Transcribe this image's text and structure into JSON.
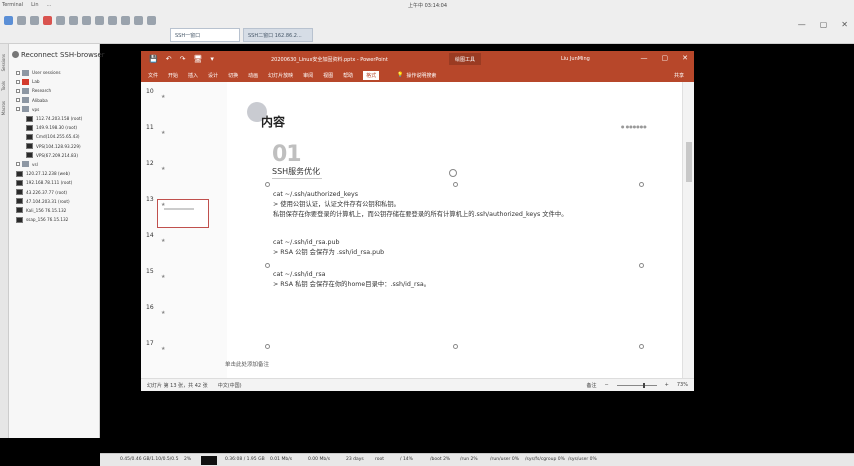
{
  "host": {
    "menu": [
      "Terminal",
      "Lin",
      "..."
    ],
    "clock": "上午中 03:14:04",
    "tabs": [
      "SSH一窗口",
      "SSH二窗口 162.86.2...",
      ""
    ],
    "window_controls": [
      "—",
      "▢",
      "✕"
    ]
  },
  "sidebar": {
    "vertical_labels": [
      "Sessions",
      "Tools",
      "Macros"
    ],
    "title": "Reconnect SSH-browser",
    "items": [
      {
        "label": "User sessions",
        "icon": "folder",
        "level": 1
      },
      {
        "label": "Lab",
        "icon": "red",
        "level": 1
      },
      {
        "label": "Research",
        "icon": "folder",
        "level": 1
      },
      {
        "label": "Alibaba",
        "icon": "folder",
        "level": 1
      },
      {
        "label": "vps",
        "icon": "folder",
        "level": 1
      },
      {
        "label": "112.74.203.158 (root)",
        "icon": "term",
        "level": 2
      },
      {
        "label": "149.9.198.30 (root)",
        "icon": "term",
        "level": 2
      },
      {
        "label": "Cmd(104.255.65.43)",
        "icon": "term",
        "level": 2
      },
      {
        "label": "VPS(104.128.93.229)",
        "icon": "term",
        "level": 2
      },
      {
        "label": "VPS(67.209.214.83)",
        "icon": "term",
        "level": 2
      },
      {
        "label": "vsl",
        "icon": "folder",
        "level": 1
      },
      {
        "label": "120.27.12.238 (web)",
        "icon": "term",
        "level": 1
      },
      {
        "label": "192.168.78.111 (root)",
        "icon": "term",
        "level": 1
      },
      {
        "label": "43.226.37.77 (root)",
        "icon": "term",
        "level": 1
      },
      {
        "label": "47.104.203.31 (root)",
        "icon": "term",
        "level": 1
      },
      {
        "label": "Kali_156 76.15.132",
        "icon": "term",
        "level": 1
      },
      {
        "label": "ssap_156 76.15.132",
        "icon": "term",
        "level": 1
      }
    ]
  },
  "ppt": {
    "quick_access": [
      "💾",
      "↶",
      "↷",
      "🖥",
      "▾"
    ],
    "filename": "20200630_Linux安全加固资料.pptx - PowerPoint",
    "tool_tab": "绘图工具",
    "user": "Liu JunMing",
    "window_controls": [
      "—",
      "▢",
      "✕"
    ],
    "ribbon_tabs": [
      "文件",
      "开始",
      "插入",
      "设计",
      "切换",
      "动画",
      "幻灯片放映",
      "审阅",
      "视图",
      "帮助",
      "格式"
    ],
    "ribbon_selected": "格式",
    "tell_me": "操作说明搜索",
    "share": "共享",
    "slide_numbers": [
      "10",
      "11",
      "12",
      "13",
      "14",
      "15",
      "16",
      "17"
    ],
    "slide": {
      "heading": "内容",
      "corner_mark": "● ●●●●●●",
      "section_number": "01",
      "section_title": "SSH服务优化",
      "blocks": [
        {
          "cmd": "cat ~/.ssh/authorized_keys",
          "lines": [
            "> 使用公钥认证，认证文件存有公钥和私钥。",
            "  私钥保存在你要登录的计算机上，而公钥存储在要登录的所有计算机上的.ssh/authorized_keys 文件中。"
          ]
        },
        {
          "cmd": "cat ~/.ssh/id_rsa.pub",
          "lines": [
            "> RSA 公钥 会保存为 .ssh/id_rsa.pub"
          ]
        },
        {
          "cmd": "cat ~/.ssh/id_rsa",
          "lines": [
            "> RSA 私钥 会保存在你的home目录中：.ssh/id_rsa。"
          ]
        }
      ]
    },
    "notes_placeholder": "单击此处添加备注",
    "status": {
      "slide_of": "幻灯片 第 13 张，共 42 张",
      "language": "中文(中国)",
      "notes_btn": "备注",
      "zoom": "73%"
    }
  },
  "host_bottom": {
    "items": [
      "0.45/0.46 GB/1.10/0.5/0.5",
      "2%",
      "0.36:08 / 1.95 GB",
      "0.01 Mb/s",
      "0.00 Mb/s",
      "23 days",
      "root",
      "/ 14%",
      "/boot 2%",
      "/run 2%",
      "/run/user 0%",
      "/sys/fs/cgroup 0%",
      "/sys/user 0%"
    ]
  },
  "colors": {
    "ppt_accent": "#b7472a",
    "selection": "#c0504d"
  }
}
